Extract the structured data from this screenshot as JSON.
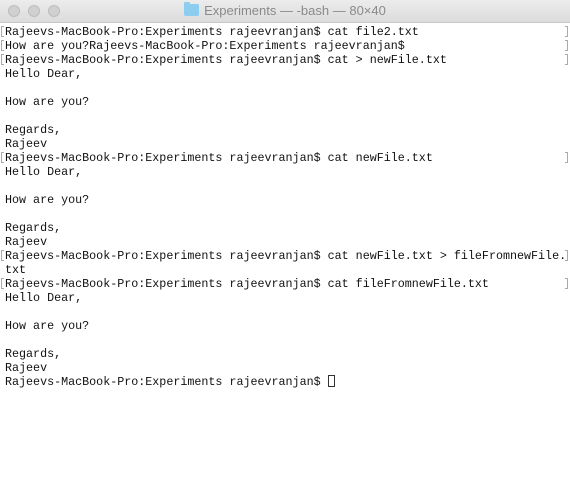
{
  "window": {
    "title": "Experiments — -bash — 80×40",
    "folder_icon": "folder-icon"
  },
  "terminal": {
    "lines": [
      {
        "text": "Rajeevs-MacBook-Pro:Experiments rajeevranjan$ cat file2.txt",
        "marked": true
      },
      {
        "text": "How are you?Rajeevs-MacBook-Pro:Experiments rajeevranjan$",
        "marked": true
      },
      {
        "text": "Rajeevs-MacBook-Pro:Experiments rajeevranjan$ cat > newFile.txt",
        "marked": true
      },
      {
        "text": "Hello Dear,",
        "marked": false
      },
      {
        "text": "",
        "marked": false
      },
      {
        "text": "How are you?",
        "marked": false
      },
      {
        "text": "",
        "marked": false
      },
      {
        "text": "Regards,",
        "marked": false
      },
      {
        "text": "Rajeev",
        "marked": false
      },
      {
        "text": "Rajeevs-MacBook-Pro:Experiments rajeevranjan$ cat newFile.txt",
        "marked": true
      },
      {
        "text": "Hello Dear,",
        "marked": false
      },
      {
        "text": "",
        "marked": false
      },
      {
        "text": "How are you?",
        "marked": false
      },
      {
        "text": "",
        "marked": false
      },
      {
        "text": "Regards,",
        "marked": false
      },
      {
        "text": "Rajeev",
        "marked": false
      },
      {
        "text": "Rajeevs-MacBook-Pro:Experiments rajeevranjan$ cat newFile.txt > fileFromnewFile.",
        "marked": true
      },
      {
        "text": "txt",
        "marked": false
      },
      {
        "text": "Rajeevs-MacBook-Pro:Experiments rajeevranjan$ cat fileFromnewFile.txt",
        "marked": true
      },
      {
        "text": "Hello Dear,",
        "marked": false
      },
      {
        "text": "",
        "marked": false
      },
      {
        "text": "How are you?",
        "marked": false
      },
      {
        "text": "",
        "marked": false
      },
      {
        "text": "Regards,",
        "marked": false
      },
      {
        "text": "Rajeev",
        "marked": false
      }
    ],
    "prompt": "Rajeevs-MacBook-Pro:Experiments rajeevranjan$ "
  }
}
